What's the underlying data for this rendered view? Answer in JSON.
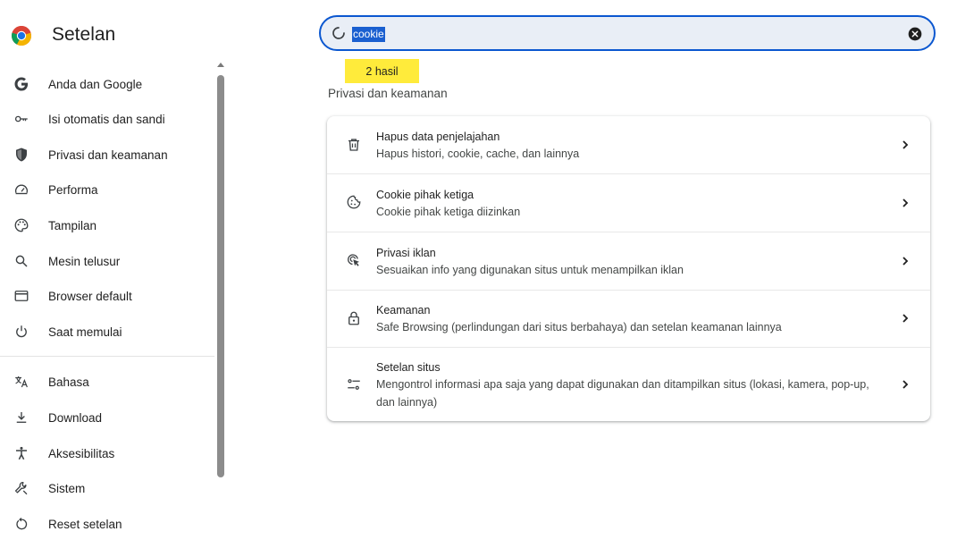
{
  "app": {
    "title": "Setelan"
  },
  "sidebar": {
    "items": [
      {
        "label": "Anda dan Google",
        "icon": "google-icon"
      },
      {
        "label": "Isi otomatis dan sandi",
        "icon": "key-icon"
      },
      {
        "label": "Privasi dan keamanan",
        "icon": "shield-icon"
      },
      {
        "label": "Performa",
        "icon": "gauge-icon"
      },
      {
        "label": "Tampilan",
        "icon": "palette-icon"
      },
      {
        "label": "Mesin telusur",
        "icon": "search-icon"
      },
      {
        "label": "Browser default",
        "icon": "browser-window-icon"
      },
      {
        "label": "Saat memulai",
        "icon": "power-icon"
      },
      {
        "label": "Bahasa",
        "icon": "translate-icon"
      },
      {
        "label": "Download",
        "icon": "download-icon"
      },
      {
        "label": "Aksesibilitas",
        "icon": "accessibility-icon"
      },
      {
        "label": "Sistem",
        "icon": "wrench-icon"
      },
      {
        "label": "Reset setelan",
        "icon": "reset-icon"
      }
    ]
  },
  "search": {
    "value": "cookie"
  },
  "results": {
    "count_label": "2 hasil"
  },
  "section": {
    "title": "Privasi dan keamanan"
  },
  "card": {
    "rows": [
      {
        "title": "Hapus data penjelajahan",
        "subtitle": "Hapus histori, cookie, cache, dan lainnya",
        "icon": "trash-icon"
      },
      {
        "title": "Cookie pihak ketiga",
        "subtitle": "Cookie pihak ketiga diizinkan",
        "icon": "cookie-icon"
      },
      {
        "title": "Privasi iklan",
        "subtitle": "Sesuaikan info yang digunakan situs untuk menampilkan iklan",
        "icon": "ad-privacy-icon"
      },
      {
        "title": "Keamanan",
        "subtitle": "Safe Browsing (perlindungan dari situs berbahaya) dan setelan keamanan lainnya",
        "icon": "lock-icon"
      },
      {
        "title": "Setelan situs",
        "subtitle": "Mengontrol informasi apa saja yang dapat digunakan dan ditampilkan situs (lokasi, kamera, pop-up, dan lainnya)",
        "icon": "tune-icon"
      }
    ]
  },
  "colors": {
    "accent": "#0b57d0",
    "highlight": "#ffeb3b",
    "search_bg": "#e9eef6"
  }
}
